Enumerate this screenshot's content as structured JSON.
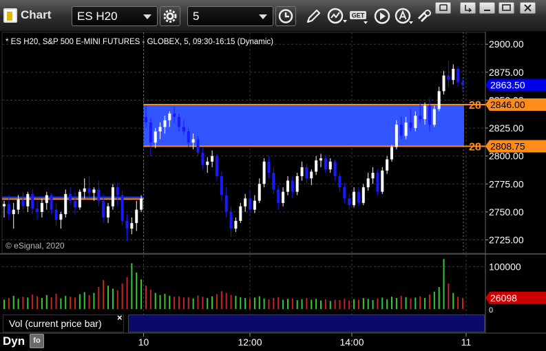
{
  "toolbar": {
    "app_title": "Chart",
    "symbol_value": "ES H20",
    "interval_value": "5",
    "buttons": [
      {
        "name": "settings-gear-icon"
      },
      {
        "name": "interval-clock-icon"
      },
      {
        "name": "draw-pencil-icon"
      },
      {
        "name": "studies-icon"
      },
      {
        "name": "get-data-icon"
      },
      {
        "name": "play-replay-icon"
      },
      {
        "name": "alert-icon"
      },
      {
        "name": "link-icon"
      }
    ]
  },
  "window_controls": [
    "restore-icon",
    "minimize-icon",
    "maximize-icon",
    "close-icon"
  ],
  "chart_header": "* ES H20, S&P 500 E-MINI FUTURES - GLOBEX, 5, 09:30-16:15 (Dynamic)",
  "copyright": "© eSignal, 2020",
  "price_axis": {
    "ticks": [
      "2900.00",
      "2875.00",
      "2850.00",
      "2825.00",
      "2800.00",
      "2775.00",
      "2750.00",
      "2725.00"
    ],
    "current_price": "2863.50",
    "upper_line_price": "2846.00",
    "lower_line_price": "2808.75",
    "line_label_prefix": "28"
  },
  "volume_axis": {
    "tick": "100000",
    "zero": "0",
    "current_volume": "26098"
  },
  "time_axis": {
    "ticks": [
      "10",
      "12:00",
      "14:00",
      "11"
    ]
  },
  "volume_panel": {
    "label": "Vol (current price bar)",
    "close_symbol": "×"
  },
  "status": {
    "mode": "Dyn"
  },
  "colors": {
    "up_candle": "#ffffff",
    "down_candle": "#1a1aff",
    "zone_fill": "#3355ff",
    "level_line": "#ff8c1a",
    "current_price_bg": "#0000e6",
    "volume_up": "#33cc33",
    "volume_down": "#cc2222",
    "volume_current_bg": "#cc0000"
  },
  "chart_data": {
    "type": "candlestick",
    "y_range": [
      2713,
      2910
    ],
    "volume_range": [
      0,
      125000
    ],
    "zone": {
      "low": 2808.75,
      "high": 2846.0
    },
    "prior_day_levels": [
      2761.5,
      2763.0
    ],
    "candles": [
      [
        2755,
        2760,
        2745,
        2757
      ],
      [
        2757,
        2765,
        2743,
        2748
      ],
      [
        2748,
        2758,
        2735,
        2752
      ],
      [
        2752,
        2765,
        2748,
        2761
      ],
      [
        2761,
        2768,
        2752,
        2755
      ],
      [
        2755,
        2768,
        2750,
        2766
      ],
      [
        2766,
        2770,
        2748,
        2753
      ],
      [
        2753,
        2760,
        2743,
        2750
      ],
      [
        2750,
        2762,
        2745,
        2758
      ],
      [
        2758,
        2768,
        2752,
        2765
      ],
      [
        2765,
        2767,
        2748,
        2752
      ],
      [
        2752,
        2758,
        2738,
        2743
      ],
      [
        2743,
        2750,
        2735,
        2748
      ],
      [
        2748,
        2770,
        2745,
        2766
      ],
      [
        2766,
        2772,
        2756,
        2760
      ],
      [
        2760,
        2768,
        2748,
        2754
      ],
      [
        2754,
        2770,
        2752,
        2768
      ],
      [
        2768,
        2780,
        2762,
        2771
      ],
      [
        2771,
        2782,
        2762,
        2767
      ],
      [
        2767,
        2772,
        2760,
        2770
      ],
      [
        2770,
        2778,
        2755,
        2760
      ],
      [
        2760,
        2766,
        2740,
        2745
      ],
      [
        2745,
        2758,
        2740,
        2755
      ],
      [
        2755,
        2775,
        2752,
        2772
      ],
      [
        2772,
        2776,
        2755,
        2765
      ],
      [
        2765,
        2769,
        2738,
        2742
      ],
      [
        2742,
        2748,
        2724,
        2735
      ],
      [
        2735,
        2745,
        2730,
        2740
      ],
      [
        2740,
        2760,
        2733,
        2752
      ],
      [
        2752,
        2765,
        2750,
        2762
      ],
      [
        2835,
        2845,
        2825,
        2830
      ],
      [
        2830,
        2834,
        2800,
        2812
      ],
      [
        2812,
        2825,
        2807,
        2822
      ],
      [
        2822,
        2830,
        2815,
        2826
      ],
      [
        2826,
        2836,
        2820,
        2832
      ],
      [
        2832,
        2840,
        2826,
        2838
      ],
      [
        2838,
        2844,
        2830,
        2835
      ],
      [
        2835,
        2838,
        2822,
        2826
      ],
      [
        2826,
        2832,
        2818,
        2822
      ],
      [
        2822,
        2825,
        2808,
        2812
      ],
      [
        2812,
        2820,
        2806,
        2815
      ],
      [
        2815,
        2818,
        2800,
        2803
      ],
      [
        2803,
        2808,
        2788,
        2792
      ],
      [
        2792,
        2799,
        2785,
        2795
      ],
      [
        2795,
        2805,
        2790,
        2800
      ],
      [
        2800,
        2802,
        2778,
        2782
      ],
      [
        2782,
        2786,
        2760,
        2765
      ],
      [
        2765,
        2772,
        2745,
        2750
      ],
      [
        2750,
        2755,
        2728,
        2735
      ],
      [
        2735,
        2745,
        2732,
        2742
      ],
      [
        2742,
        2758,
        2740,
        2755
      ],
      [
        2755,
        2766,
        2750,
        2762
      ],
      [
        2762,
        2770,
        2748,
        2752
      ],
      [
        2752,
        2765,
        2749,
        2760
      ],
      [
        2760,
        2780,
        2758,
        2775
      ],
      [
        2775,
        2798,
        2772,
        2795
      ],
      [
        2795,
        2800,
        2780,
        2785
      ],
      [
        2785,
        2790,
        2766,
        2770
      ],
      [
        2770,
        2774,
        2752,
        2758
      ],
      [
        2758,
        2772,
        2755,
        2768
      ],
      [
        2768,
        2782,
        2765,
        2778
      ],
      [
        2778,
        2782,
        2762,
        2768
      ],
      [
        2768,
        2785,
        2765,
        2782
      ],
      [
        2782,
        2795,
        2778,
        2790
      ],
      [
        2790,
        2793,
        2775,
        2780
      ],
      [
        2780,
        2788,
        2774,
        2786
      ],
      [
        2786,
        2800,
        2783,
        2796
      ],
      [
        2796,
        2802,
        2790,
        2798
      ],
      [
        2798,
        2800,
        2785,
        2788
      ],
      [
        2788,
        2798,
        2785,
        2795
      ],
      [
        2795,
        2797,
        2778,
        2782
      ],
      [
        2782,
        2785,
        2768,
        2772
      ],
      [
        2772,
        2776,
        2758,
        2762
      ],
      [
        2762,
        2766,
        2752,
        2756
      ],
      [
        2756,
        2772,
        2754,
        2768
      ],
      [
        2768,
        2772,
        2755,
        2758
      ],
      [
        2758,
        2775,
        2756,
        2772
      ],
      [
        2772,
        2785,
        2769,
        2780
      ],
      [
        2780,
        2790,
        2775,
        2785
      ],
      [
        2785,
        2788,
        2765,
        2768
      ],
      [
        2768,
        2790,
        2766,
        2787
      ],
      [
        2787,
        2800,
        2784,
        2797
      ],
      [
        2797,
        2810,
        2795,
        2808
      ],
      [
        2808,
        2832,
        2806,
        2828
      ],
      [
        2828,
        2835,
        2815,
        2818
      ],
      [
        2818,
        2835,
        2815,
        2830
      ],
      [
        2830,
        2842,
        2822,
        2825
      ],
      [
        2825,
        2840,
        2822,
        2836
      ],
      [
        2836,
        2848,
        2830,
        2833
      ],
      [
        2833,
        2848,
        2828,
        2845
      ],
      [
        2845,
        2852,
        2822,
        2828
      ],
      [
        2828,
        2845,
        2826,
        2842
      ],
      [
        2842,
        2862,
        2840,
        2858
      ],
      [
        2858,
        2876,
        2855,
        2872
      ],
      [
        2872,
        2885,
        2862,
        2868
      ],
      [
        2868,
        2882,
        2864,
        2878
      ],
      [
        2878,
        2880,
        2862,
        2866
      ],
      [
        2866,
        2870,
        2858,
        2863.5
      ]
    ],
    "volumes": [
      22000,
      26000,
      31000,
      24000,
      29000,
      27000,
      34000,
      30000,
      26000,
      33000,
      28000,
      36000,
      25000,
      31000,
      29000,
      27000,
      35000,
      40000,
      33000,
      38000,
      52000,
      68000,
      55000,
      48000,
      44000,
      60000,
      75000,
      108000,
      86000,
      70000,
      55000,
      46000,
      38000,
      33000,
      36000,
      31000,
      29000,
      30000,
      27000,
      28000,
      25000,
      32000,
      29000,
      26000,
      30000,
      35000,
      42000,
      38000,
      33000,
      31000,
      28000,
      26000,
      24000,
      27000,
      30000,
      25000,
      23000,
      26000,
      28000,
      22000,
      24000,
      25000,
      21000,
      23000,
      26000,
      22000,
      24000,
      20000,
      23000,
      19000,
      22000,
      21000,
      24000,
      20000,
      23000,
      22000,
      26000,
      24000,
      21000,
      25000,
      27000,
      23000,
      29000,
      26000,
      31000,
      28000,
      25000,
      27000,
      30000,
      26000,
      34000,
      41000,
      52000,
      118000,
      60000,
      38000,
      29000,
      26098
    ]
  }
}
